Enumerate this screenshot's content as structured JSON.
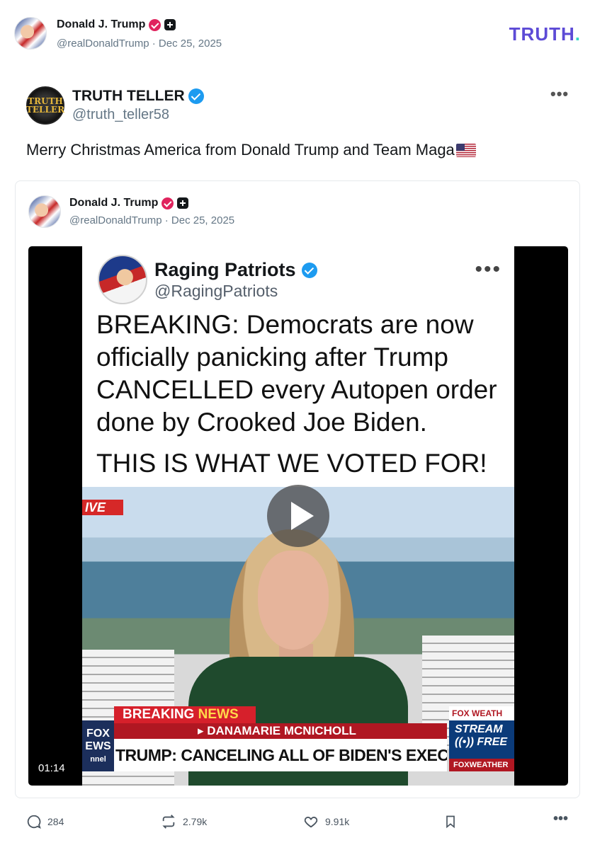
{
  "author": {
    "name": "Donald J. Trump",
    "handle": "@realDonaldTrump",
    "separator": "·",
    "date": "Dec 25, 2025"
  },
  "logo": {
    "text": "TRUTH",
    "dot": "."
  },
  "post": {
    "author_name": "TRUTH TELLER",
    "author_handle": "@truth_teller58",
    "avatar_text_1": "TRUTH",
    "avatar_text_2": "TELLER",
    "text": "Merry Christmas America from Donald Trump and Team Maga",
    "emoji_icon": "us-flag-icon"
  },
  "quoted_post": {
    "author_name": "Donald J. Trump",
    "handle": "@realDonaldTrump",
    "separator": "·",
    "date": "Dec 25, 2025"
  },
  "video": {
    "duration": "01:14",
    "tweet": {
      "name": "Raging Patriots",
      "handle": "@RagingPatriots",
      "more": "•••",
      "body": "BREAKING: Democrats are now officially panicking after Trump CANCELLED every Autopen order done by Crooked Joe Biden.",
      "shout": "THIS IS WHAT WE VOTED FOR!"
    },
    "broadcast": {
      "live_tag": "IVE",
      "breaking": "BREAKING",
      "news": "NEWS",
      "reporter": "▸ DANAMARIE MCNICHOLL",
      "headline": "TRUMP: CANCELING ALL OF BIDEN'S EXECUTIVE ORDERS",
      "fox_logo": "FOX EWS",
      "channel": "nnel",
      "weather_top": "FOX WEATH",
      "weather_mid1": "STREAM",
      "weather_mid2": "((•)) FREE",
      "weather_bottom": "FOXWEATHER"
    }
  },
  "actions": {
    "replies": "284",
    "retruths": "2.79k",
    "likes": "9.91k"
  },
  "colors": {
    "verified_red": "#e0245e",
    "verified_blue": "#1d9bf0",
    "logo_purple": "#5d4bd6",
    "logo_dot": "#33d6c3"
  }
}
